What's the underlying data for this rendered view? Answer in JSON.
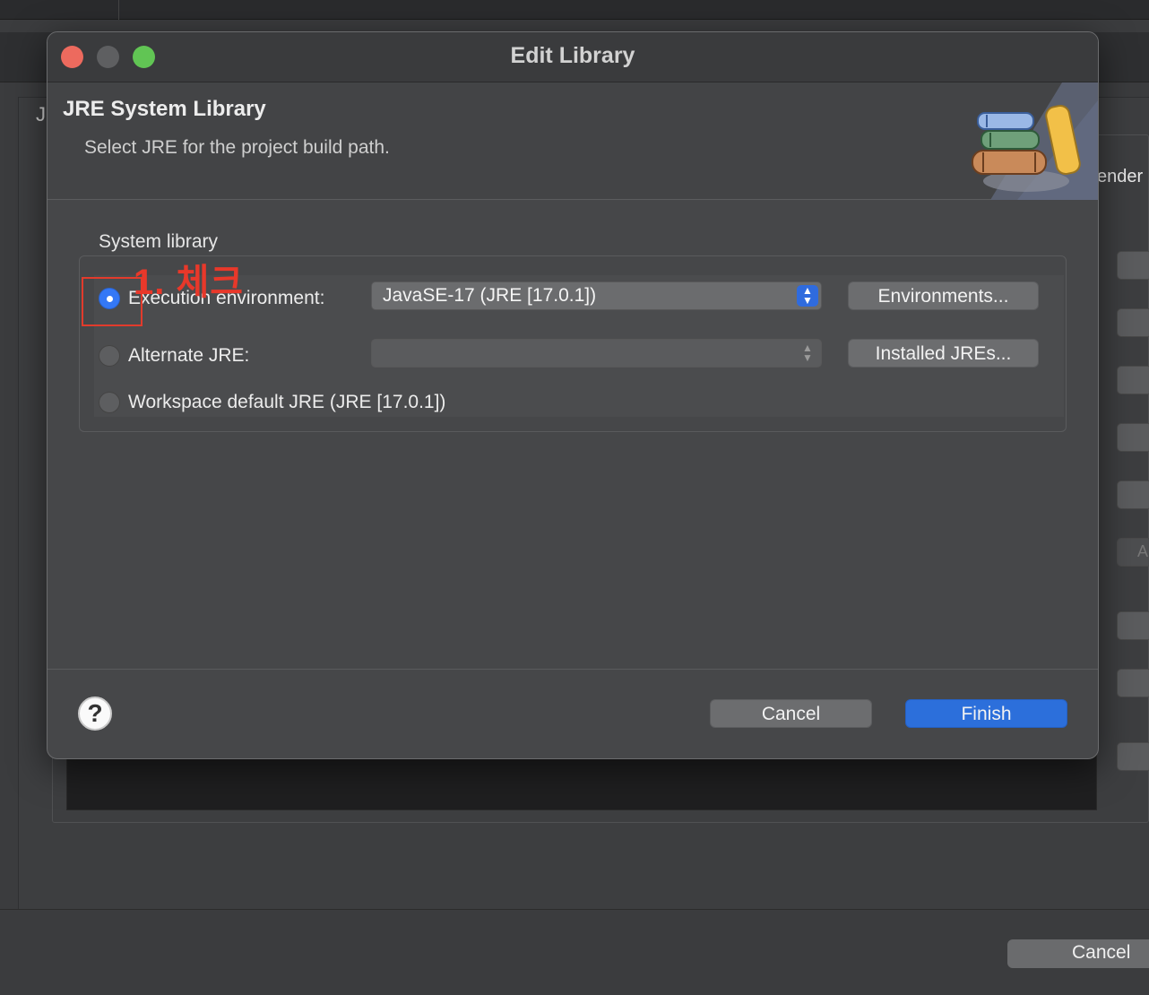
{
  "background": {
    "letter": "J",
    "tab_text": "ender",
    "side_button_text": "A",
    "cancel_label": "Cancel"
  },
  "dialog": {
    "title": "Edit Library",
    "header": {
      "title": "JRE System Library",
      "description": "Select JRE for the project build path."
    },
    "section_label": "System library",
    "options": {
      "execution_env": {
        "label": "Execution environment:",
        "selected": true,
        "select_value": "JavaSE-17 (JRE [17.0.1])",
        "button": "Environments..."
      },
      "alternate_jre": {
        "label": "Alternate JRE:",
        "selected": false,
        "select_value": "",
        "button": "Installed JREs..."
      },
      "workspace_default": {
        "label": "Workspace default JRE (JRE [17.0.1])",
        "selected": false
      }
    },
    "footer": {
      "help": "?",
      "cancel_label": "Cancel",
      "finish_label": "Finish"
    }
  },
  "annotation": {
    "text": "1. 체크",
    "color": "#e8382a"
  },
  "colors": {
    "accent": "#2c6fdb",
    "close": "#ed6a5e",
    "maximize": "#61c554"
  },
  "icons": [
    "close-icon",
    "minimize-icon",
    "maximize-icon",
    "books-icon",
    "chevron-updown-icon",
    "help-icon"
  ]
}
